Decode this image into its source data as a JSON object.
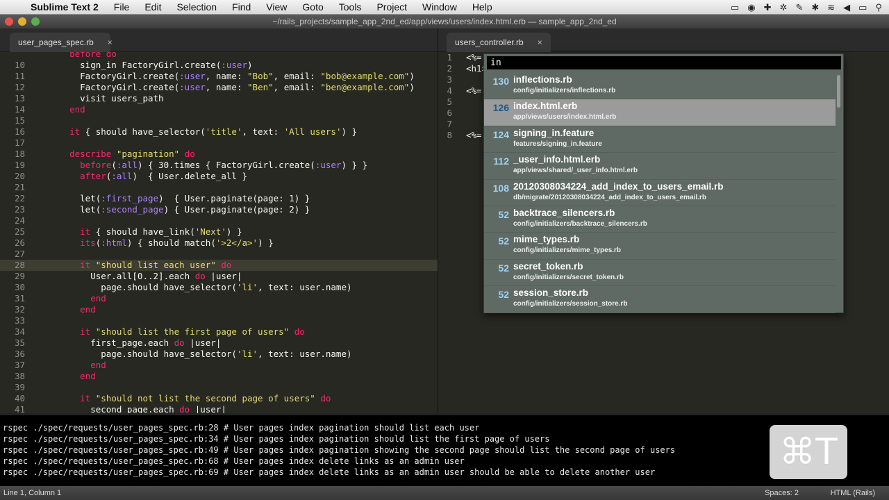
{
  "menubar": {
    "app": "Sublime Text 2",
    "items": [
      "File",
      "Edit",
      "Selection",
      "Find",
      "View",
      "Goto",
      "Tools",
      "Project",
      "Window",
      "Help"
    ]
  },
  "window": {
    "title": "~/rails_projects/sample_app_2nd_ed/app/views/users/index.html.erb — sample_app_2nd_ed"
  },
  "tabs": {
    "left": "user_pages_spec.rb",
    "right": "users_controller.rb",
    "close_glyph": "×"
  },
  "left_code": [
    {
      "n": "",
      "t": "    before do"
    },
    {
      "n": "10",
      "t": "      sign_in FactoryGirl.create(:user)"
    },
    {
      "n": "11",
      "t": "      FactoryGirl.create(:user, name: \"Bob\", email: \"bob@example.com\")"
    },
    {
      "n": "12",
      "t": "      FactoryGirl.create(:user, name: \"Ben\", email: \"ben@example.com\")"
    },
    {
      "n": "13",
      "t": "      visit users_path"
    },
    {
      "n": "14",
      "t": "    end"
    },
    {
      "n": "15",
      "t": ""
    },
    {
      "n": "16",
      "t": "    it { should have_selector('title', text: 'All users') }"
    },
    {
      "n": "17",
      "t": ""
    },
    {
      "n": "18",
      "t": "    describe \"pagination\" do"
    },
    {
      "n": "19",
      "t": "      before(:all) { 30.times { FactoryGirl.create(:user) } }"
    },
    {
      "n": "20",
      "t": "      after(:all)  { User.delete_all }"
    },
    {
      "n": "21",
      "t": ""
    },
    {
      "n": "22",
      "t": "      let(:first_page)  { User.paginate(page: 1) }"
    },
    {
      "n": "23",
      "t": "      let(:second_page) { User.paginate(page: 2) }"
    },
    {
      "n": "24",
      "t": ""
    },
    {
      "n": "25",
      "t": "      it { should have_link('Next') }"
    },
    {
      "n": "26",
      "t": "      its(:html) { should match('>2</a>') }"
    },
    {
      "n": "27",
      "t": ""
    },
    {
      "n": "28",
      "t": "      it \"should list each user\" do"
    },
    {
      "n": "29",
      "t": "        User.all[0..2].each do |user|"
    },
    {
      "n": "30",
      "t": "          page.should have_selector('li', text: user.name)"
    },
    {
      "n": "31",
      "t": "        end"
    },
    {
      "n": "32",
      "t": "      end"
    },
    {
      "n": "33",
      "t": ""
    },
    {
      "n": "34",
      "t": "      it \"should list the first page of users\" do"
    },
    {
      "n": "35",
      "t": "        first_page.each do |user|"
    },
    {
      "n": "36",
      "t": "          page.should have_selector('li', text: user.name)"
    },
    {
      "n": "37",
      "t": "        end"
    },
    {
      "n": "38",
      "t": "      end"
    },
    {
      "n": "39",
      "t": ""
    },
    {
      "n": "40",
      "t": "      it \"should not list the second page of users\" do"
    },
    {
      "n": "41",
      "t": "        second_page.each do |user|"
    }
  ],
  "right_code": [
    {
      "n": "1",
      "t": "<%="
    },
    {
      "n": "2",
      "t": "<h1>"
    },
    {
      "n": "3",
      "t": ""
    },
    {
      "n": "4",
      "t": "<%="
    },
    {
      "n": "5",
      "t": ""
    },
    {
      "n": "6",
      "t": ""
    },
    {
      "n": "7",
      "t": ""
    },
    {
      "n": "8",
      "t": "<%="
    }
  ],
  "goto": {
    "query": "in",
    "results": [
      {
        "score": "130",
        "name": "inflections.rb",
        "path": "config/initializers/inflections.rb"
      },
      {
        "score": "126",
        "name": "index.html.erb",
        "path": "app/views/users/index.html.erb"
      },
      {
        "score": "124",
        "name": "signing_in.feature",
        "path": "features/signing_in.feature"
      },
      {
        "score": "112",
        "name": "_user_info.html.erb",
        "path": "app/views/shared/_user_info.html.erb"
      },
      {
        "score": "108",
        "name": "20120308034224_add_index_to_users_email.rb",
        "path": "db/migrate/20120308034224_add_index_to_users_email.rb"
      },
      {
        "score": "52",
        "name": "backtrace_silencers.rb",
        "path": "config/initializers/backtrace_silencers.rb"
      },
      {
        "score": "52",
        "name": "mime_types.rb",
        "path": "config/initializers/mime_types.rb"
      },
      {
        "score": "52",
        "name": "secret_token.rb",
        "path": "config/initializers/secret_token.rb"
      },
      {
        "score": "52",
        "name": "session_store.rb",
        "path": "config/initializers/session_store.rb"
      }
    ]
  },
  "console": [
    "rspec ./spec/requests/user_pages_spec.rb:28 # User pages index pagination should list each user",
    "rspec ./spec/requests/user_pages_spec.rb:34 # User pages index pagination should list the first page of users",
    "rspec ./spec/requests/user_pages_spec.rb:49 # User pages index pagination showing the second page should list the second page of users",
    "rspec ./spec/requests/user_pages_spec.rb:68 # User pages index delete links as an admin user",
    "rspec ./spec/requests/user_pages_spec.rb:69 # User pages index delete links as an admin user should be able to delete another user"
  ],
  "shortcut_overlay": "⌘T",
  "statusbar": {
    "position": "Line 1, Column 1",
    "spaces": "Spaces: 2",
    "syntax": "HTML (Rails)"
  },
  "colors": {
    "editor_bg": "#272822",
    "keyword": "#f92672",
    "string": "#e6db74",
    "symbol": "#ae81ff"
  }
}
